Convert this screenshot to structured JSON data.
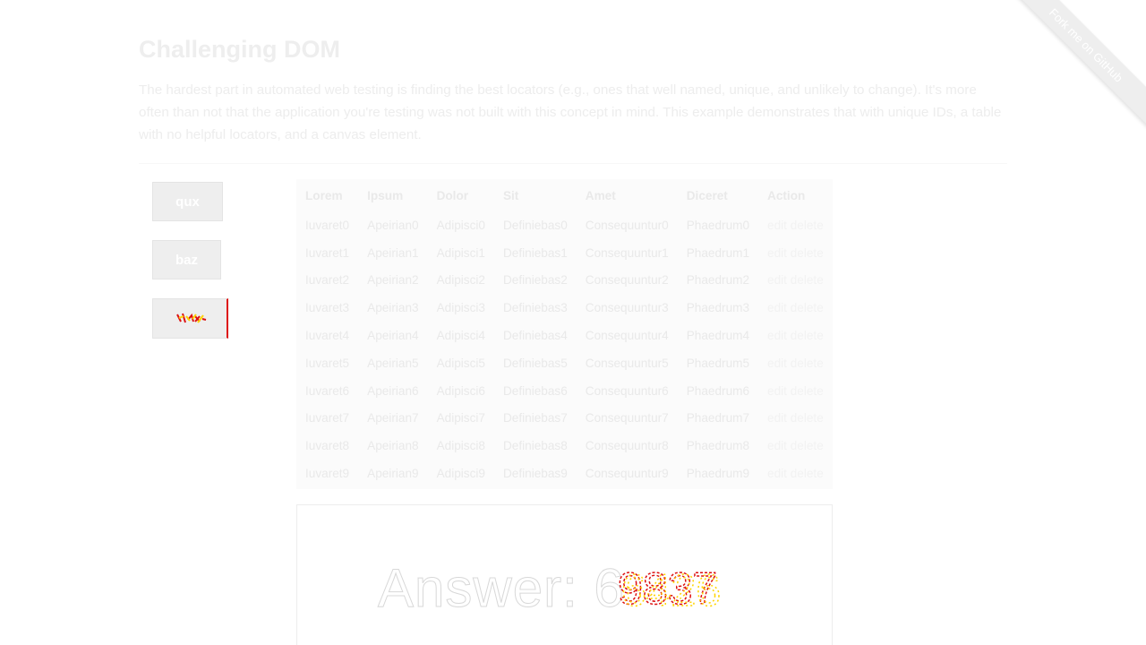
{
  "ribbon": {
    "label": "Fork me on GitHub"
  },
  "heading": "Challenging DOM",
  "intro": "The hardest part in automated web testing is finding the best locators (e.g., ones that well named, unique, and unlikely to change). It's more often than not that the application you're testing was not built with this concept in mind. This example demonstrates that with unique IDs, a table with no helpful locators, and a canvas element.",
  "buttons": [
    {
      "label": "qux"
    },
    {
      "label": "baz"
    },
    {
      "label": "qux"
    }
  ],
  "table": {
    "headers": [
      "Lorem",
      "Ipsum",
      "Dolor",
      "Sit",
      "Amet",
      "Diceret",
      "Action"
    ],
    "edit_label": "edit",
    "delete_label": "delete",
    "rows": [
      [
        "Iuvaret0",
        "Apeirian0",
        "Adipisci0",
        "Definiebas0",
        "Consequuntur0",
        "Phaedrum0"
      ],
      [
        "Iuvaret1",
        "Apeirian1",
        "Adipisci1",
        "Definiebas1",
        "Consequuntur1",
        "Phaedrum1"
      ],
      [
        "Iuvaret2",
        "Apeirian2",
        "Adipisci2",
        "Definiebas2",
        "Consequuntur2",
        "Phaedrum2"
      ],
      [
        "Iuvaret3",
        "Apeirian3",
        "Adipisci3",
        "Definiebas3",
        "Consequuntur3",
        "Phaedrum3"
      ],
      [
        "Iuvaret4",
        "Apeirian4",
        "Adipisci4",
        "Definiebas4",
        "Consequuntur4",
        "Phaedrum4"
      ],
      [
        "Iuvaret5",
        "Apeirian5",
        "Adipisci5",
        "Definiebas5",
        "Consequuntur5",
        "Phaedrum5"
      ],
      [
        "Iuvaret6",
        "Apeirian6",
        "Adipisci6",
        "Definiebas6",
        "Consequuntur6",
        "Phaedrum6"
      ],
      [
        "Iuvaret7",
        "Apeirian7",
        "Adipisci7",
        "Definiebas7",
        "Consequuntur7",
        "Phaedrum7"
      ],
      [
        "Iuvaret8",
        "Apeirian8",
        "Adipisci8",
        "Definiebas8",
        "Consequuntur8",
        "Phaedrum8"
      ],
      [
        "Iuvaret9",
        "Apeirian9",
        "Adipisci9",
        "Definiebas9",
        "Consequuntur9",
        "Phaedrum9"
      ]
    ]
  },
  "canvas": {
    "answer_text": "Answer: 6"
  },
  "colors": {
    "heading": "#eeeeee",
    "body_text": "#ededed",
    "button_bg": "#eeeeee",
    "button_highlight": "#dd1010",
    "scramble_red": "#dd1010",
    "scramble_yellow": "#ffd400"
  }
}
